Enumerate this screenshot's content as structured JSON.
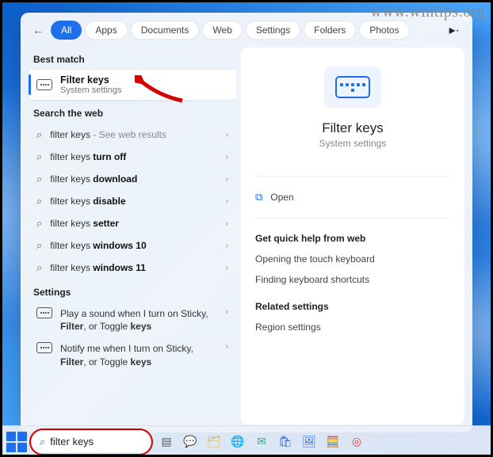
{
  "watermark": "www.wintips.org",
  "tabs": {
    "items": [
      "All",
      "Apps",
      "Documents",
      "Web",
      "Settings",
      "Folders",
      "Photos"
    ],
    "active_index": 0,
    "has_more": true
  },
  "left": {
    "best_match_header": "Best match",
    "best_match": {
      "title": "Filter keys",
      "subtitle": "System settings"
    },
    "web_header": "Search the web",
    "web_results": [
      {
        "prefix": "filter keys",
        "bold": "",
        "hint": " - See web results"
      },
      {
        "prefix": "filter keys ",
        "bold": "turn off",
        "hint": ""
      },
      {
        "prefix": "filter keys ",
        "bold": "download",
        "hint": ""
      },
      {
        "prefix": "filter keys ",
        "bold": "disable",
        "hint": ""
      },
      {
        "prefix": "filter keys ",
        "bold": "setter",
        "hint": ""
      },
      {
        "prefix": "filter keys ",
        "bold": "windows 10",
        "hint": ""
      },
      {
        "prefix": "filter keys ",
        "bold": "windows 11",
        "hint": ""
      }
    ],
    "settings_header": "Settings",
    "settings_results": [
      {
        "pre": "Play a sound when I turn on Sticky, ",
        "bold": "Filter",
        "post": ", or Toggle ",
        "bold2": "keys"
      },
      {
        "pre": "Notify me when I turn on Sticky, ",
        "bold": "Filter",
        "post": ", or Toggle ",
        "bold2": "keys"
      }
    ]
  },
  "right": {
    "title": "Filter keys",
    "subtitle": "System settings",
    "open_label": "Open",
    "help_header": "Get quick help from web",
    "help_links": [
      "Opening the touch keyboard",
      "Finding keyboard shortcuts"
    ],
    "related_header": "Related settings",
    "related_links": [
      "Region settings"
    ]
  },
  "taskbar": {
    "search_value": "filter keys",
    "icons": [
      {
        "name": "task-view-icon",
        "glyph": "▤",
        "color": "#555"
      },
      {
        "name": "chat-icon",
        "glyph": "💬",
        "color": "#4a8"
      },
      {
        "name": "explorer-icon",
        "glyph": "🗂",
        "color": "#e7b14a"
      },
      {
        "name": "edge-icon",
        "glyph": "🌐",
        "color": "#1f8"
      },
      {
        "name": "mail-icon",
        "glyph": "✉",
        "color": "#3a7"
      },
      {
        "name": "store-icon",
        "glyph": "🛍",
        "color": "#36c"
      },
      {
        "name": "photos-icon",
        "glyph": "🖼",
        "color": "#36c"
      },
      {
        "name": "calculator-icon",
        "glyph": "🧮",
        "color": "#36c"
      },
      {
        "name": "chrome-icon",
        "glyph": "◎",
        "color": "#d44"
      }
    ]
  }
}
